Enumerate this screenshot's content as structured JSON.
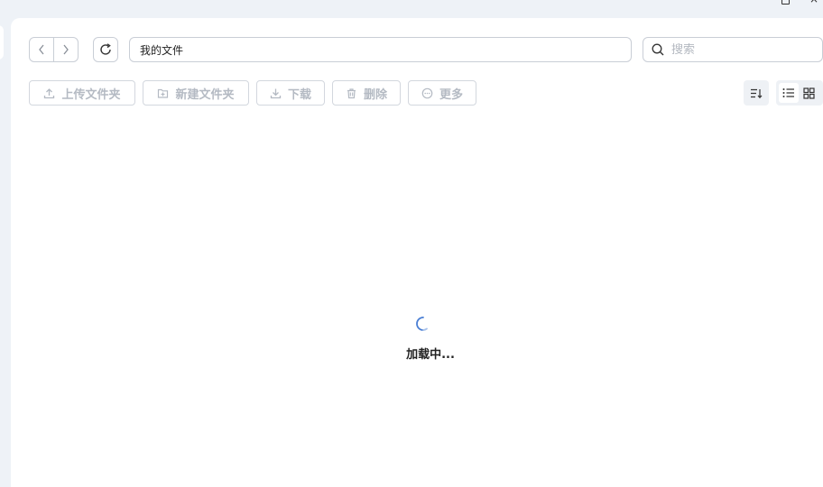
{
  "window": {
    "restore_icon": "restore-icon",
    "close_icon": "close-icon",
    "close_glyph": "×"
  },
  "nav": {
    "back_icon": "chevron-left-icon",
    "forward_icon": "chevron-right-icon",
    "refresh_icon": "refresh-icon"
  },
  "path": {
    "value": "我的文件"
  },
  "search": {
    "placeholder": "搜索",
    "icon": "search-icon"
  },
  "toolbar": {
    "upload_folder_label": "上传文件夹",
    "new_folder_label": "新建文件夹",
    "download_label": "下载",
    "delete_label": "删除",
    "more_label": "更多"
  },
  "view": {
    "sort_icon": "sort-icon",
    "list_icon": "list-view-icon",
    "grid_icon": "grid-view-icon",
    "active": "list"
  },
  "status": {
    "loading_text": "加载中..."
  },
  "colors": {
    "accent": "#4a7fd4",
    "disabled_text": "#b4bac3",
    "border": "#c9ced6",
    "background": "#eef2f7"
  }
}
